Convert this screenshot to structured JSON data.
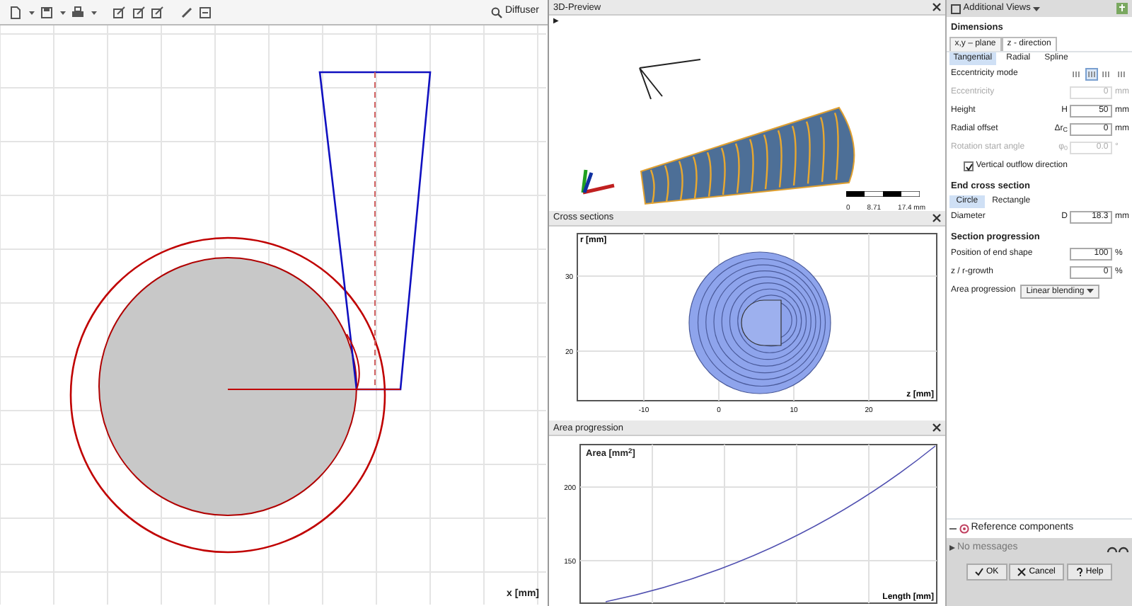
{
  "toolbar": {
    "search_label": "Diffuser"
  },
  "main_view": {
    "axis_label": "x [mm]"
  },
  "preview_3d": {
    "title": "3D-Preview",
    "play": "▶",
    "scale_labels": [
      "0",
      "8.71",
      "17.4 mm"
    ]
  },
  "cross_sections": {
    "title": "Cross sections",
    "ylabel": "r [mm]",
    "xlabel": "z [mm]",
    "yticks": [
      "30",
      "20"
    ],
    "xticks": [
      "-10",
      "0",
      "10",
      "20"
    ]
  },
  "area_progression": {
    "title": "Area progression",
    "ylabel": "Area [mm$^{2}$]",
    "xlabel": "Length [mm]",
    "yticks": [
      "200",
      "150"
    ]
  },
  "panel": {
    "title": "Additional Views",
    "dimensions": {
      "title": "Dimensions",
      "tabs": [
        {
          "label": "x,y – plane",
          "selected": false
        },
        {
          "label": "z - direction",
          "selected": true
        }
      ],
      "subtabs": [
        {
          "label": "Tangential",
          "selected": true
        },
        {
          "label": "Radial",
          "selected": false
        },
        {
          "label": "Spline",
          "selected": false
        }
      ],
      "rows": [
        {
          "kind": "modes",
          "label": "Eccentricity mode",
          "options": [
            {
              "selected": false
            },
            {
              "selected": true
            },
            {
              "selected": false
            },
            {
              "selected": false
            }
          ]
        },
        {
          "kind": "field",
          "label": "Eccentricity",
          "value": "0",
          "unit": "mm",
          "disabled": true
        },
        {
          "kind": "field",
          "label": "Height",
          "symbol": "H",
          "value": "50",
          "unit": "mm",
          "disabled": false
        },
        {
          "kind": "field",
          "label": "Radial offset",
          "symbol": "Δr$_{C}$",
          "value": "0",
          "unit": "mm",
          "disabled": false
        },
        {
          "kind": "field",
          "label": "Rotation start angle",
          "symbol": "φ$_{0}$",
          "value": "0.0",
          "unit": "°",
          "disabled": true
        },
        {
          "kind": "checkbox",
          "label": "Vertical outflow direction",
          "checked": true
        }
      ]
    },
    "end_section": {
      "title": "End cross section",
      "shapes": [
        {
          "label": "Circle",
          "selected": true
        },
        {
          "label": "Rectangle",
          "selected": false
        }
      ],
      "rows": [
        {
          "kind": "field",
          "label": "Diameter",
          "symbol": "D",
          "value": "18.3",
          "unit": "mm",
          "disabled": false
        }
      ]
    },
    "section_progression": {
      "title": "Section progression",
      "rows": [
        {
          "kind": "field",
          "label": "Position of end shape",
          "value": "100",
          "unit": "%",
          "disabled": false
        },
        {
          "kind": "field",
          "label": "z / r-growth",
          "value": "0",
          "unit": "%",
          "disabled": false
        },
        {
          "kind": "select",
          "label": "Area progression",
          "value": "Linear blending"
        }
      ]
    },
    "reference": {
      "label": "Reference components"
    },
    "messages": "No messages",
    "buttons": [
      {
        "kind": "ok",
        "label": "OK"
      },
      {
        "kind": "cancel",
        "label": "Cancel"
      },
      {
        "kind": "help",
        "label": "Help"
      }
    ]
  }
}
